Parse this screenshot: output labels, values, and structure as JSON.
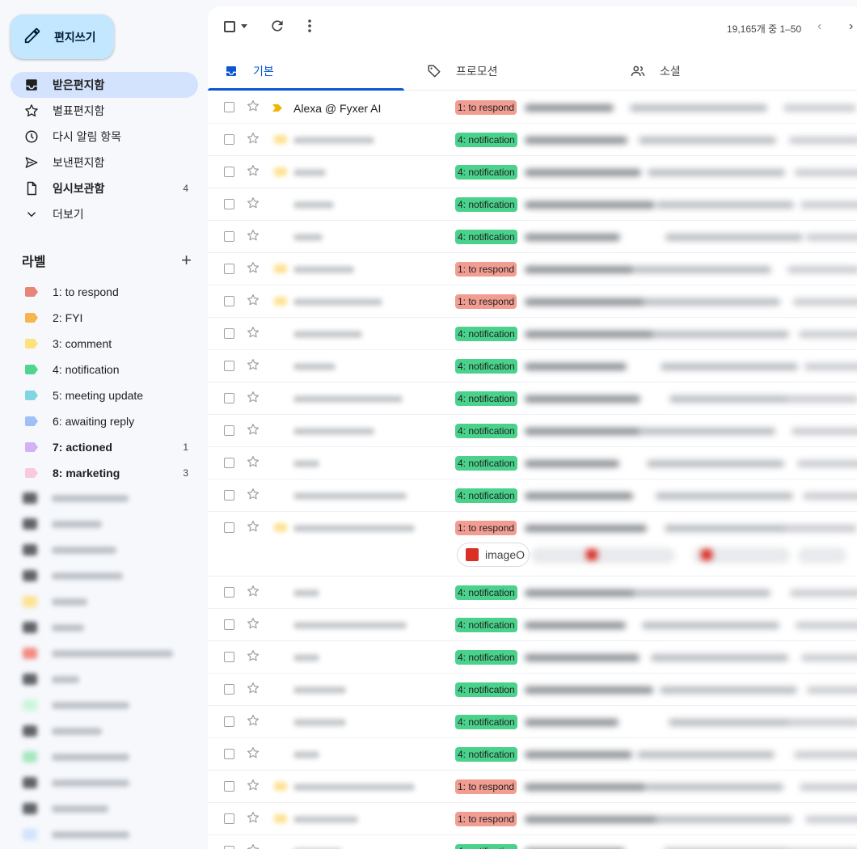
{
  "compose": {
    "label": "편지쓰기",
    "icon": "pencil-icon"
  },
  "nav": [
    {
      "label": "받은편지함",
      "icon": "inbox-icon",
      "count": "",
      "active": true
    },
    {
      "label": "별표편지함",
      "icon": "star-icon",
      "count": ""
    },
    {
      "label": "다시 알림 항목",
      "icon": "clock-icon",
      "count": ""
    },
    {
      "label": "보낸편지함",
      "icon": "send-icon",
      "count": ""
    },
    {
      "label": "임시보관함",
      "icon": "draft-icon",
      "count": "4",
      "bold": true
    },
    {
      "label": "더보기",
      "icon": "chevron-down-icon",
      "count": ""
    }
  ],
  "labels_header": {
    "title": "라벨",
    "add": "+"
  },
  "labels": [
    {
      "label": "1: to respond",
      "color": "#e8857a",
      "count": ""
    },
    {
      "label": "2: FYI",
      "color": "#f8b44e",
      "count": ""
    },
    {
      "label": "3: comment",
      "color": "#fde27a",
      "count": ""
    },
    {
      "label": "4: notification",
      "color": "#4fd58f",
      "count": ""
    },
    {
      "label": "5: meeting update",
      "color": "#7fd5e0",
      "count": ""
    },
    {
      "label": "6: awaiting reply",
      "color": "#9fbff7",
      "count": ""
    },
    {
      "label": "7: actioned",
      "color": "#d1b3f5",
      "count": "1",
      "bold": true
    },
    {
      "label": "8: marketing",
      "color": "#f9c9dc",
      "count": "3",
      "bold": true
    }
  ],
  "toolbar": {
    "page_count": "19,165개 중 1–50",
    "prev": "‹",
    "next": "›"
  },
  "tabs": [
    {
      "label": "기본",
      "icon": "inbox-tab-icon",
      "active": true
    },
    {
      "label": "프로모션",
      "icon": "tag-icon"
    },
    {
      "label": "소셜",
      "icon": "people-icon"
    }
  ],
  "colors": {
    "to_respond": "#f19d92",
    "notification": "#4ad28c",
    "accent": "#0b57d0"
  },
  "emails": [
    {
      "sender": "Alexa @ Fyxer AI",
      "badge": "1: to respond",
      "type": "respond"
    },
    {
      "sender": "",
      "badge": "4: notification",
      "type": "notification"
    },
    {
      "sender": "",
      "badge": "4: notification",
      "type": "notification"
    },
    {
      "sender": "",
      "badge": "4: notification",
      "type": "notification"
    },
    {
      "sender": "",
      "badge": "4: notification",
      "type": "notification"
    },
    {
      "sender": "",
      "badge": "1: to respond",
      "type": "respond"
    },
    {
      "sender": "",
      "badge": "1: to respond",
      "type": "respond"
    },
    {
      "sender": "",
      "badge": "4: notification",
      "type": "notification"
    },
    {
      "sender": "",
      "badge": "4: notification",
      "type": "notification"
    },
    {
      "sender": "",
      "badge": "4: notification",
      "type": "notification"
    },
    {
      "sender": "",
      "badge": "4: notification",
      "type": "notification"
    },
    {
      "sender": "",
      "badge": "4: notification",
      "type": "notification"
    },
    {
      "sender": "",
      "badge": "4: notification",
      "type": "notification"
    },
    {
      "sender": "",
      "badge": "1: to respond",
      "type": "respond",
      "attachment": "imageO"
    },
    {
      "sender": "",
      "badge": "4: notification",
      "type": "notification"
    },
    {
      "sender": "",
      "badge": "4: notification",
      "type": "notification"
    },
    {
      "sender": "",
      "badge": "4: notification",
      "type": "notification"
    },
    {
      "sender": "",
      "badge": "4: notification",
      "type": "notification"
    },
    {
      "sender": "",
      "badge": "4: notification",
      "type": "notification"
    },
    {
      "sender": "",
      "badge": "4: notification",
      "type": "notification"
    },
    {
      "sender": "",
      "badge": "1: to respond",
      "type": "respond"
    },
    {
      "sender": "",
      "badge": "1: to respond",
      "type": "respond"
    },
    {
      "sender": "",
      "badge": "4: notification",
      "type": "notification"
    }
  ]
}
